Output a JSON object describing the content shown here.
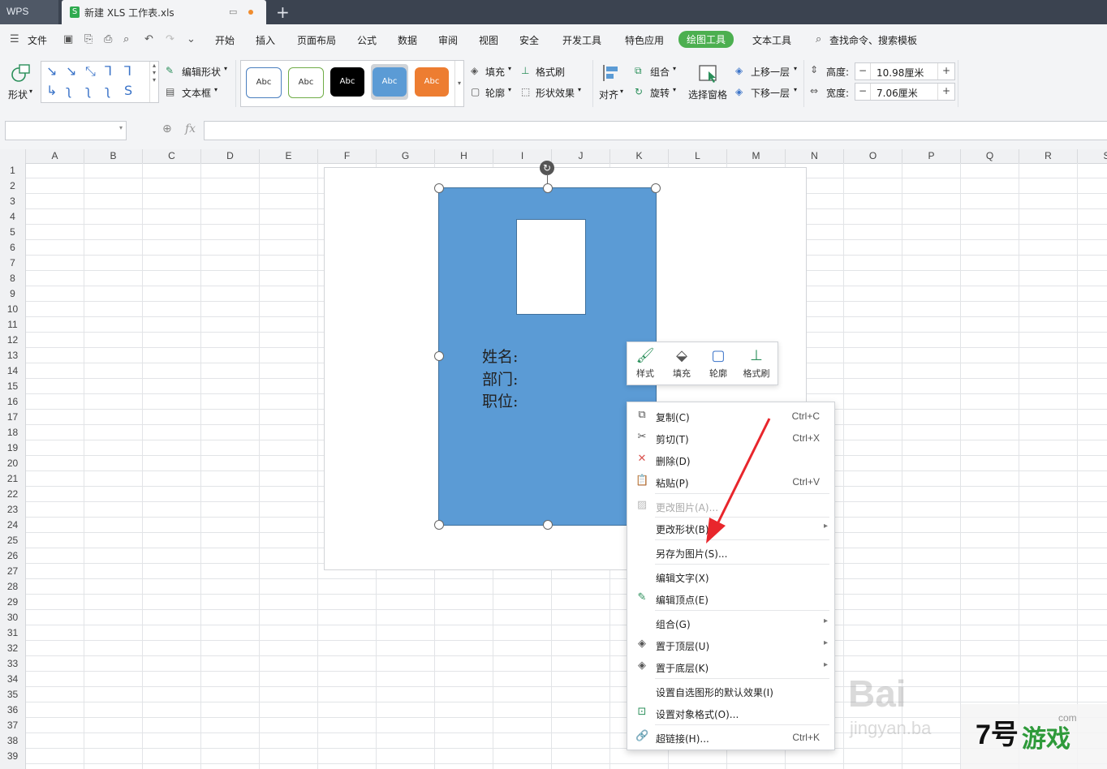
{
  "titlebar": {
    "app_tab": "WPS",
    "doc_tab": "新建 XLS 工作表.xls",
    "doc_icon": "S",
    "new_tab": "+"
  },
  "menubar": {
    "file": "文件",
    "items": [
      "开始",
      "插入",
      "页面布局",
      "公式",
      "数据",
      "审阅",
      "视图",
      "安全",
      "开发工具",
      "特色应用",
      "绘图工具",
      "文本工具"
    ],
    "active": "绘图工具",
    "search": "查找命令、搜索模板"
  },
  "ribbon": {
    "shape_label": "形状",
    "edit_shape": "编辑形状",
    "text_box": "文本框",
    "style_sample": "Abc",
    "fill": "填充",
    "format_painter": "格式刷",
    "outline": "轮廓",
    "shape_effect": "形状效果",
    "align": "对齐",
    "group": "组合",
    "rotate": "旋转",
    "selection_pane": "选择窗格",
    "bring_forward": "上移一层",
    "send_backward": "下移一层",
    "height_label": "高度:",
    "height_value": "10.98厘米",
    "width_label": "宽度:",
    "width_value": "7.06厘米",
    "minus": "−",
    "plus": "+"
  },
  "formula_bar": {
    "fx": "fx"
  },
  "grid": {
    "columns": [
      "A",
      "B",
      "C",
      "D",
      "E",
      "F",
      "G",
      "H",
      "I",
      "J",
      "K",
      "L",
      "M",
      "N",
      "O",
      "P",
      "Q",
      "R",
      "S"
    ],
    "rows": [
      "1",
      "2",
      "3",
      "4",
      "5",
      "6",
      "7",
      "8",
      "9",
      "10",
      "11",
      "12",
      "13",
      "14",
      "15",
      "16",
      "17",
      "18",
      "19",
      "20",
      "21",
      "22",
      "23",
      "24",
      "25",
      "26",
      "27",
      "28",
      "29",
      "30",
      "31",
      "32",
      "33",
      "34",
      "35",
      "36",
      "37",
      "38",
      "39"
    ]
  },
  "card": {
    "fill_color": "#5b9bd5",
    "line1": "姓名:",
    "line2": "部门:",
    "line3": "职位:"
  },
  "minibar": {
    "style": "样式",
    "fill": "填充",
    "outline": "轮廓",
    "painter": "格式刷"
  },
  "context_menu": {
    "copy": "复制(C)",
    "copy_sc": "Ctrl+C",
    "cut": "剪切(T)",
    "cut_sc": "Ctrl+X",
    "delete": "删除(D)",
    "paste": "粘贴(P)",
    "paste_sc": "Ctrl+V",
    "change_picture": "更改图片(A)...",
    "change_shape": "更改形状(B)",
    "save_as_picture": "另存为图片(S)...",
    "edit_text": "编辑文字(X)",
    "edit_points": "编辑顶点(E)",
    "group": "组合(G)",
    "bring_to_front": "置于顶层(U)",
    "send_to_back": "置于底层(K)",
    "set_default": "设置自选图形的默认效果(I)",
    "format_object": "设置对象格式(O)...",
    "hyperlink": "超链接(H)...",
    "hyperlink_sc": "Ctrl+K"
  },
  "watermark": {
    "baidu": "Bai",
    "jingyan": "jingyan.ba",
    "logo_num": "7号",
    "logo_game": "游戏",
    "logo_site": "com"
  }
}
